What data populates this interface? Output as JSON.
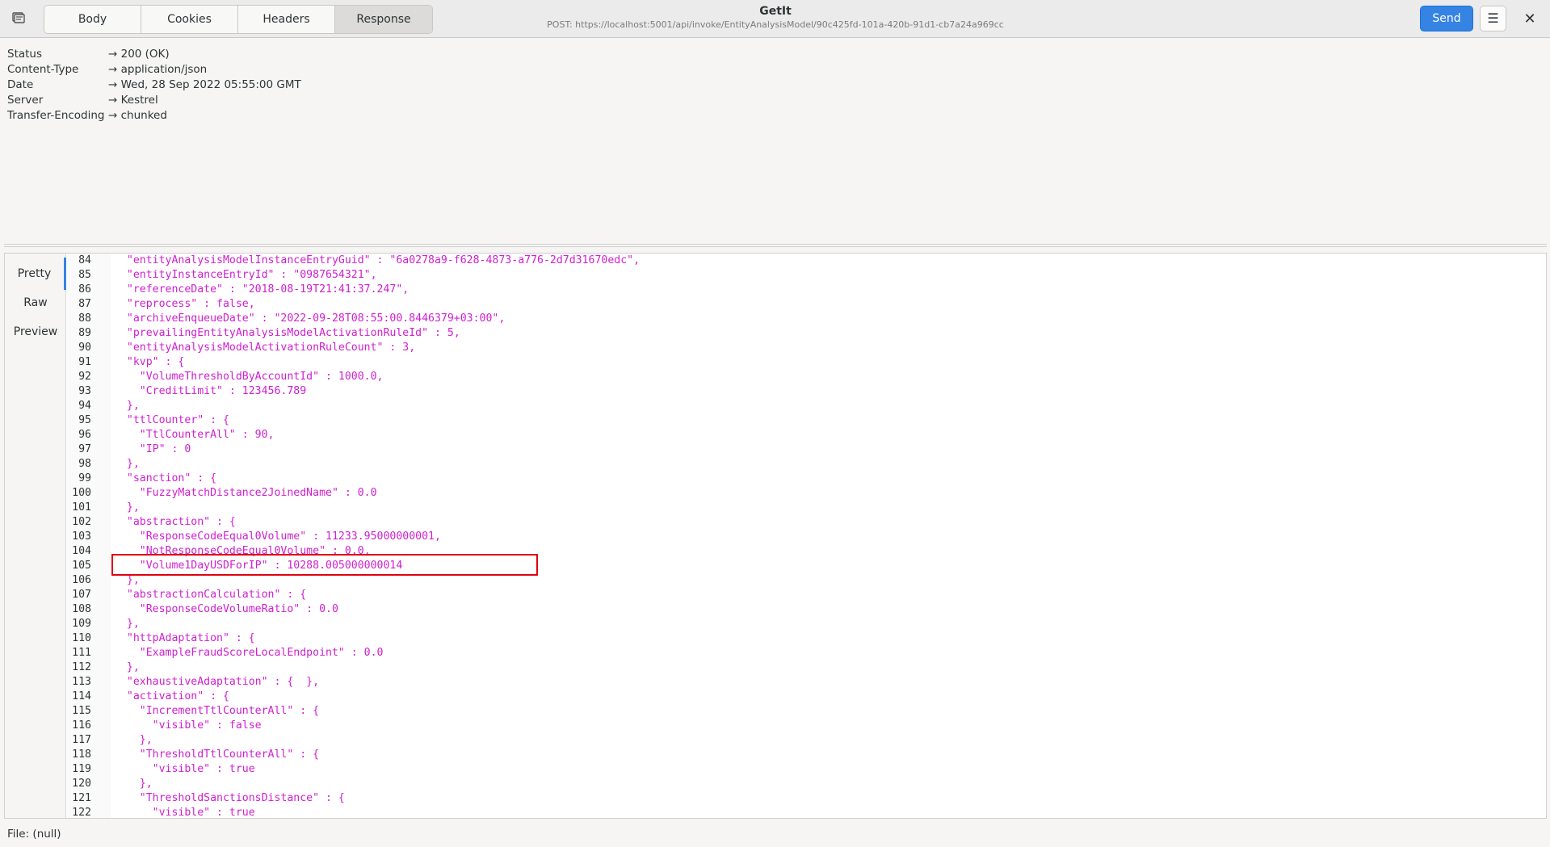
{
  "header": {
    "tabs": [
      {
        "label": "Body",
        "active": false
      },
      {
        "label": "Cookies",
        "active": false
      },
      {
        "label": "Headers",
        "active": false
      },
      {
        "label": "Response",
        "active": true
      }
    ],
    "title": "GetIt",
    "subtitle": "POST: https://localhost:5001/api/invoke/EntityAnalysisModel/90c425fd-101a-420b-91d1-cb7a24a969cc",
    "send_label": "Send",
    "menu_icon": "hamburger-icon",
    "close_icon": "close-icon"
  },
  "response_headers": [
    {
      "name": "Status",
      "value": "→ 200 (OK)"
    },
    {
      "name": "Content-Type",
      "value": "→ application/json"
    },
    {
      "name": "Date",
      "value": "→ Wed, 28 Sep 2022 05:55:00 GMT"
    },
    {
      "name": "Server",
      "value": "→ Kestrel"
    },
    {
      "name": "Transfer-Encoding",
      "value": "→ chunked"
    }
  ],
  "view_tabs": [
    {
      "label": "Pretty",
      "active": true
    },
    {
      "label": "Raw",
      "active": false
    },
    {
      "label": "Preview",
      "active": false
    }
  ],
  "code_lines": [
    {
      "n": "84",
      "t": "  \"entityAnalysisModelInstanceEntryGuid\" : \"6a0278a9-f628-4873-a776-2d7d31670edc\","
    },
    {
      "n": "85",
      "t": "  \"entityInstanceEntryId\" : \"0987654321\","
    },
    {
      "n": "86",
      "t": "  \"referenceDate\" : \"2018-08-19T21:41:37.247\","
    },
    {
      "n": "87",
      "t": "  \"reprocess\" : false,"
    },
    {
      "n": "88",
      "t": "  \"archiveEnqueueDate\" : \"2022-09-28T08:55:00.8446379+03:00\","
    },
    {
      "n": "89",
      "t": "  \"prevailingEntityAnalysisModelActivationRuleId\" : 5,"
    },
    {
      "n": "90",
      "t": "  \"entityAnalysisModelActivationRuleCount\" : 3,"
    },
    {
      "n": "91",
      "t": "  \"kvp\" : {"
    },
    {
      "n": "92",
      "t": "    \"VolumeThresholdByAccountId\" : 1000.0,"
    },
    {
      "n": "93",
      "t": "    \"CreditLimit\" : 123456.789"
    },
    {
      "n": "94",
      "t": "  },"
    },
    {
      "n": "95",
      "t": "  \"ttlCounter\" : {"
    },
    {
      "n": "96",
      "t": "    \"TtlCounterAll\" : 90,"
    },
    {
      "n": "97",
      "t": "    \"IP\" : 0"
    },
    {
      "n": "98",
      "t": "  },"
    },
    {
      "n": "99",
      "t": "  \"sanction\" : {"
    },
    {
      "n": "100",
      "t": "    \"FuzzyMatchDistance2JoinedName\" : 0.0"
    },
    {
      "n": "101",
      "t": "  },"
    },
    {
      "n": "102",
      "t": "  \"abstraction\" : {"
    },
    {
      "n": "103",
      "t": "    \"ResponseCodeEqual0Volume\" : 11233.95000000001,"
    },
    {
      "n": "104",
      "t": "    \"NotResponseCodeEqual0Volume\" : 0.0,"
    },
    {
      "n": "105",
      "t": "    \"Volume1DayUSDForIP\" : 10288.005000000014"
    },
    {
      "n": "106",
      "t": "  },"
    },
    {
      "n": "107",
      "t": "  \"abstractionCalculation\" : {"
    },
    {
      "n": "108",
      "t": "    \"ResponseCodeVolumeRatio\" : 0.0"
    },
    {
      "n": "109",
      "t": "  },"
    },
    {
      "n": "110",
      "t": "  \"httpAdaptation\" : {"
    },
    {
      "n": "111",
      "t": "    \"ExampleFraudScoreLocalEndpoint\" : 0.0"
    },
    {
      "n": "112",
      "t": "  },"
    },
    {
      "n": "113",
      "t": "  \"exhaustiveAdaptation\" : {  },"
    },
    {
      "n": "114",
      "t": "  \"activation\" : {"
    },
    {
      "n": "115",
      "t": "    \"IncrementTtlCounterAll\" : {"
    },
    {
      "n": "116",
      "t": "      \"visible\" : false"
    },
    {
      "n": "117",
      "t": "    },"
    },
    {
      "n": "118",
      "t": "    \"ThresholdTtlCounterAll\" : {"
    },
    {
      "n": "119",
      "t": "      \"visible\" : true"
    },
    {
      "n": "120",
      "t": "    },"
    },
    {
      "n": "121",
      "t": "    \"ThresholdSanctionsDistance\" : {"
    },
    {
      "n": "122",
      "t": "      \"visible\" : true"
    }
  ],
  "statusbar": {
    "text": "File: (null)"
  },
  "colors": {
    "accent": "#3584e4",
    "code_text": "#d020d0",
    "highlight_box": "#e0000f"
  }
}
